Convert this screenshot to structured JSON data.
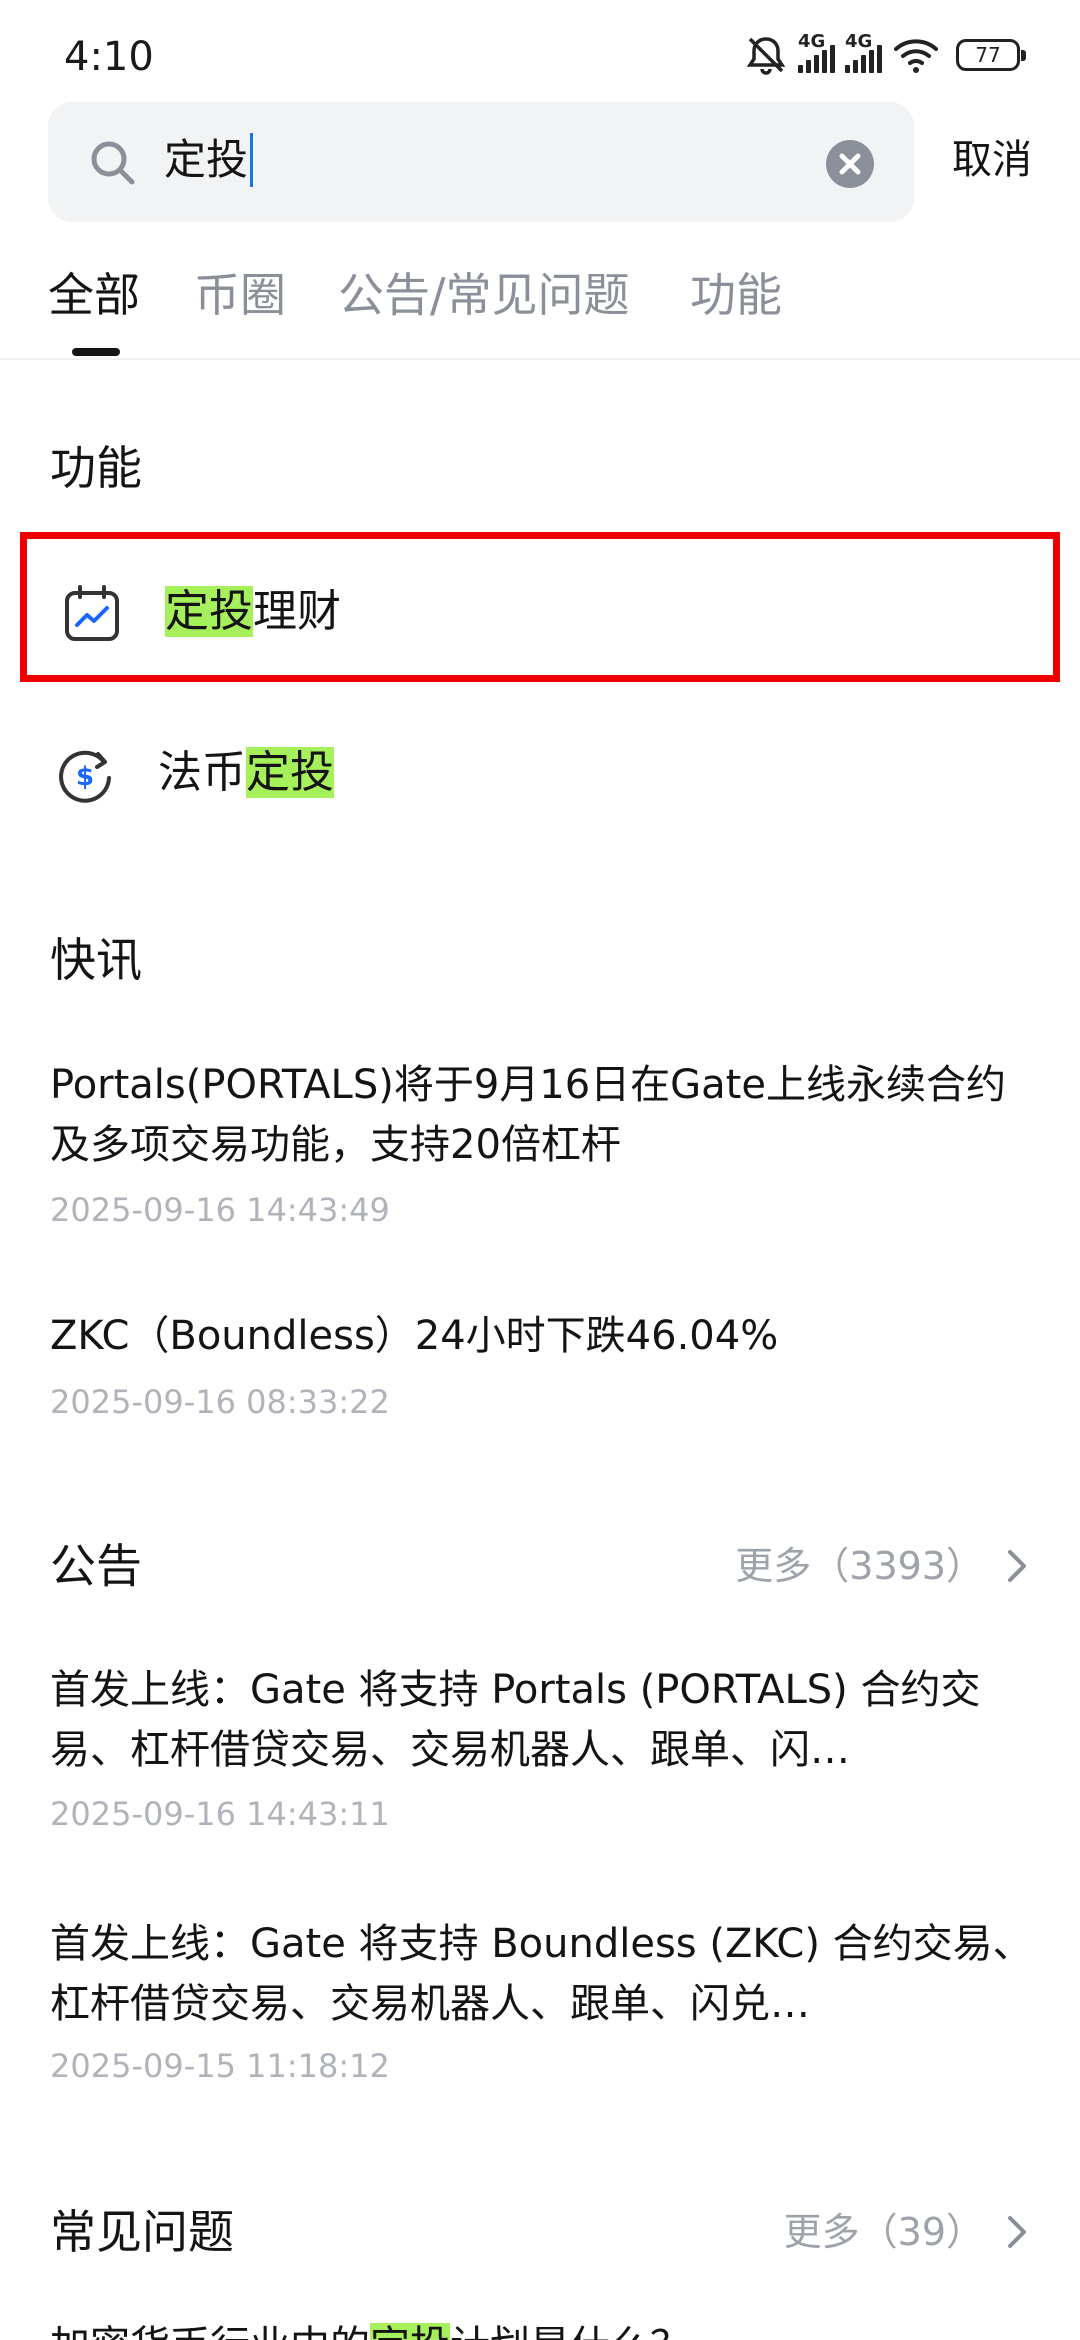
{
  "status_bar": {
    "time": "4:10",
    "network_1": "4G",
    "network_2": "4G",
    "battery": "77",
    "icons": [
      "mute-icon",
      "signal-icon",
      "signal-icon",
      "wifi-icon",
      "battery-icon"
    ]
  },
  "search": {
    "query": "定投",
    "cancel_label": "取消"
  },
  "tabs": [
    {
      "label": "全部",
      "active": true
    },
    {
      "label": "币圈",
      "active": false
    },
    {
      "label": "公告/常见问题",
      "active": false
    },
    {
      "label": "功能",
      "active": false
    }
  ],
  "functions": {
    "title": "功能",
    "items": [
      {
        "match": "定投",
        "rest": "理财",
        "icon": "calendar-chart-icon"
      },
      {
        "prefix": "法币",
        "match": "定投",
        "icon": "dollar-cycle-icon"
      }
    ]
  },
  "news": {
    "title": "快讯",
    "items": [
      {
        "title": "Portals(PORTALS)将于9月16日在Gate上线永续合约及多项交易功能，支持20倍杠杆",
        "time": "2025-09-16 14:43:49"
      },
      {
        "title": "ZKC（Boundless）24小时下跌46.04%",
        "time": "2025-09-16 08:33:22"
      }
    ]
  },
  "announcements": {
    "title": "公告",
    "more": "更多（3393）",
    "items": [
      {
        "title": "首发上线：Gate 将支持 Portals (PORTALS) 合约交易、杠杆借贷交易、交易机器人、跟单、闪…",
        "time": "2025-09-16 14:43:11"
      },
      {
        "title": "首发上线：Gate 将支持 Boundless (ZKC) 合约交易、杠杆借贷交易、交易机器人、跟单、闪兑…",
        "time": "2025-09-15 11:18:12"
      }
    ]
  },
  "faq": {
    "title": "常见问题",
    "more": "更多（39）",
    "partial_item": {
      "before": "加密货币行业中的",
      "match": "定投",
      "after": "计划是什么？"
    }
  },
  "colors": {
    "highlight": "#a6f05c",
    "selection_border": "#ee0000",
    "caret": "#1a73e8",
    "muted_text": "#9ea3ab"
  }
}
